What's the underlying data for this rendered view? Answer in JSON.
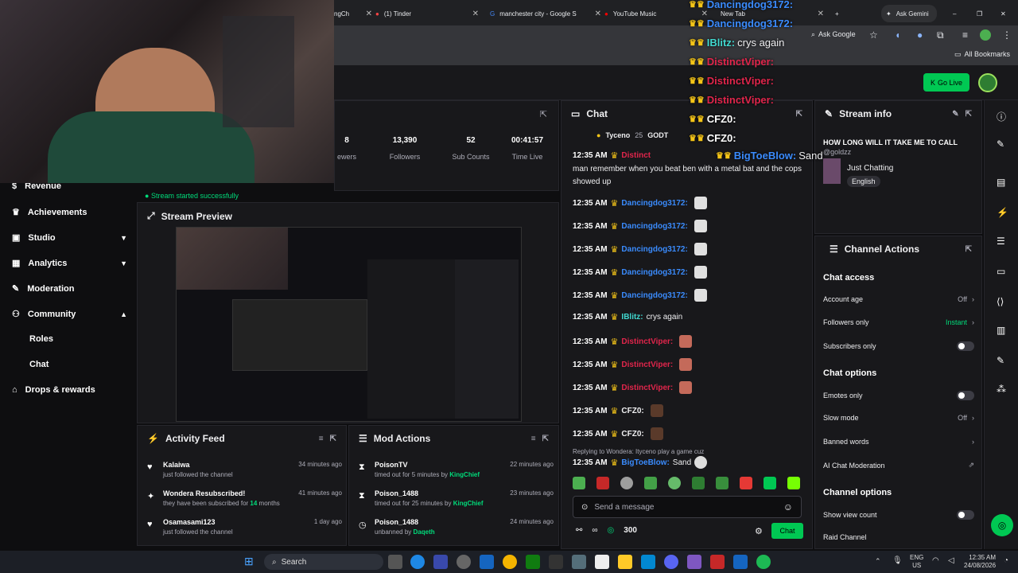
{
  "browser": {
    "tabs": [
      {
        "label": "ngCh"
      },
      {
        "label": "(1) Tinder"
      },
      {
        "label": "manchester city - Google S"
      },
      {
        "label": "YouTube Music"
      },
      {
        "label": "New Tab"
      }
    ],
    "ask_gemini": "Ask Gemini",
    "ask_google": "Ask Google",
    "all_bookmarks": "All Bookmarks"
  },
  "header": {
    "go_live": "Go Live"
  },
  "stats": [
    {
      "value": "13,390",
      "label": "Followers"
    },
    {
      "value": "52",
      "label": "Sub Counts"
    },
    {
      "value": "00:41:57",
      "label": "Time Live"
    }
  ],
  "stats_partial": {
    "value": "8",
    "label": "ewers"
  },
  "stream_status": "Stream started successfully",
  "sidebar": {
    "items": [
      {
        "label": "Revenue"
      },
      {
        "label": "Achievements"
      },
      {
        "label": "Studio"
      },
      {
        "label": "Analytics"
      },
      {
        "label": "Moderation"
      },
      {
        "label": "Community"
      },
      {
        "label": "Roles"
      },
      {
        "label": "Chat"
      },
      {
        "label": "Drops & rewards"
      }
    ]
  },
  "preview": {
    "title": "Stream Preview"
  },
  "activity_feed": {
    "title": "Activity Feed",
    "items": [
      {
        "name": "Kalaiwa",
        "sub": "just followed the channel",
        "time": "34 minutes ago"
      },
      {
        "name": "Wondera Resubscribed!",
        "sub_pre": "they have been subscribed for ",
        "sub_num": "14",
        "sub_post": " months",
        "time": "41 minutes ago"
      },
      {
        "name": "Osamasami123",
        "sub": "just followed the channel",
        "time": "1 day ago"
      }
    ]
  },
  "mod_actions": {
    "title": "Mod Actions",
    "items": [
      {
        "name": "PoisonTV",
        "pre": "timed out for 5 minutes by ",
        "by": "KingChief",
        "time": "22 minutes ago"
      },
      {
        "name": "Poison_1488",
        "pre": "timed out for 25 minutes by ",
        "by": "KingChief",
        "time": "23 minutes ago"
      },
      {
        "name": "Poison_1488",
        "pre": "unbanned by ",
        "by": "Daqeth",
        "time": "24 minutes ago"
      }
    ]
  },
  "chat": {
    "title": "Chat",
    "leaderboard": [
      {
        "name": "Tyceno",
        "count": "25"
      },
      {
        "name": "GODT"
      }
    ],
    "first_msg_user": "Distinct",
    "first_msg_text": "man remember when you beat ben with a metal bat and the cops showed up",
    "messages": [
      {
        "time": "12:35 AM",
        "user": "Dancingdog3172:",
        "color": "blue",
        "text": ""
      },
      {
        "time": "12:35 AM",
        "user": "Dancingdog3172:",
        "color": "blue",
        "text": ""
      },
      {
        "time": "12:35 AM",
        "user": "Dancingdog3172:",
        "color": "blue",
        "text": ""
      },
      {
        "time": "12:35 AM",
        "user": "Dancingdog3172:",
        "color": "blue",
        "text": ""
      },
      {
        "time": "12:35 AM",
        "user": "Dancingdog3172:",
        "color": "blue",
        "text": ""
      },
      {
        "time": "12:35 AM",
        "user": "IBlitz:",
        "color": "teal",
        "text": "crys again"
      },
      {
        "time": "12:35 AM",
        "user": "DistinctViper:",
        "color": "red",
        "text": ""
      },
      {
        "time": "12:35 AM",
        "user": "DistinctViper:",
        "color": "red",
        "text": ""
      },
      {
        "time": "12:35 AM",
        "user": "DistinctViper:",
        "color": "red",
        "text": ""
      },
      {
        "time": "12:35 AM",
        "user": "CFZ0:",
        "color": "white",
        "text": ""
      },
      {
        "time": "12:35 AM",
        "user": "CFZ0:",
        "color": "white",
        "text": ""
      }
    ],
    "reply_note": "Replying to Wondera: Ityceno play a game cuz",
    "last": {
      "time": "12:35 AM",
      "user": "BigToeBlow:",
      "text": "Sand"
    },
    "input_placeholder": "Send a message",
    "points": "300",
    "send": "Chat"
  },
  "stream_info": {
    "title": "Stream info",
    "stream_title": "HOW LONG WILL IT TAKE ME TO CALL",
    "handle": "@goldzz",
    "category": "Just Chatting",
    "tag": "English"
  },
  "channel_actions": {
    "title": "Channel Actions",
    "chat_access": "Chat access",
    "account_age": {
      "label": "Account age",
      "value": "Off"
    },
    "followers_only": {
      "label": "Followers only",
      "value": "Instant"
    },
    "subscribers_only": {
      "label": "Subscribers only"
    },
    "chat_options": "Chat options",
    "emotes_only": {
      "label": "Emotes only"
    },
    "slow_mode": {
      "label": "Slow mode",
      "value": "Off"
    },
    "banned_words": {
      "label": "Banned words"
    },
    "ai_mod": {
      "label": "AI Chat Moderation"
    },
    "channel_options": "Channel options",
    "show_view_count": {
      "label": "Show view count"
    },
    "raid": {
      "label": "Raid Channel"
    }
  },
  "overlay": [
    {
      "user": "Dancingdog3172:",
      "color": "blue",
      "text": ""
    },
    {
      "user": "Dancingdog3172:",
      "color": "blue",
      "text": ""
    },
    {
      "user": "IBlitz:",
      "color": "teal",
      "text": "crys again"
    },
    {
      "user": "DistinctViper:",
      "color": "red",
      "text": ""
    },
    {
      "user": "DistinctViper:",
      "color": "red",
      "text": ""
    },
    {
      "user": "DistinctViper:",
      "color": "red",
      "text": ""
    },
    {
      "user": "CFZ0:",
      "color": "white",
      "text": ""
    },
    {
      "user": "CFZ0:",
      "color": "white",
      "text": ""
    },
    {
      "user": "BigToeBlow:",
      "color": "blue",
      "text": "Sand"
    }
  ],
  "taskbar": {
    "search": "Search",
    "lang": "ENG",
    "region": "US",
    "time": "12:35 AM",
    "date": "24/08/2026"
  }
}
